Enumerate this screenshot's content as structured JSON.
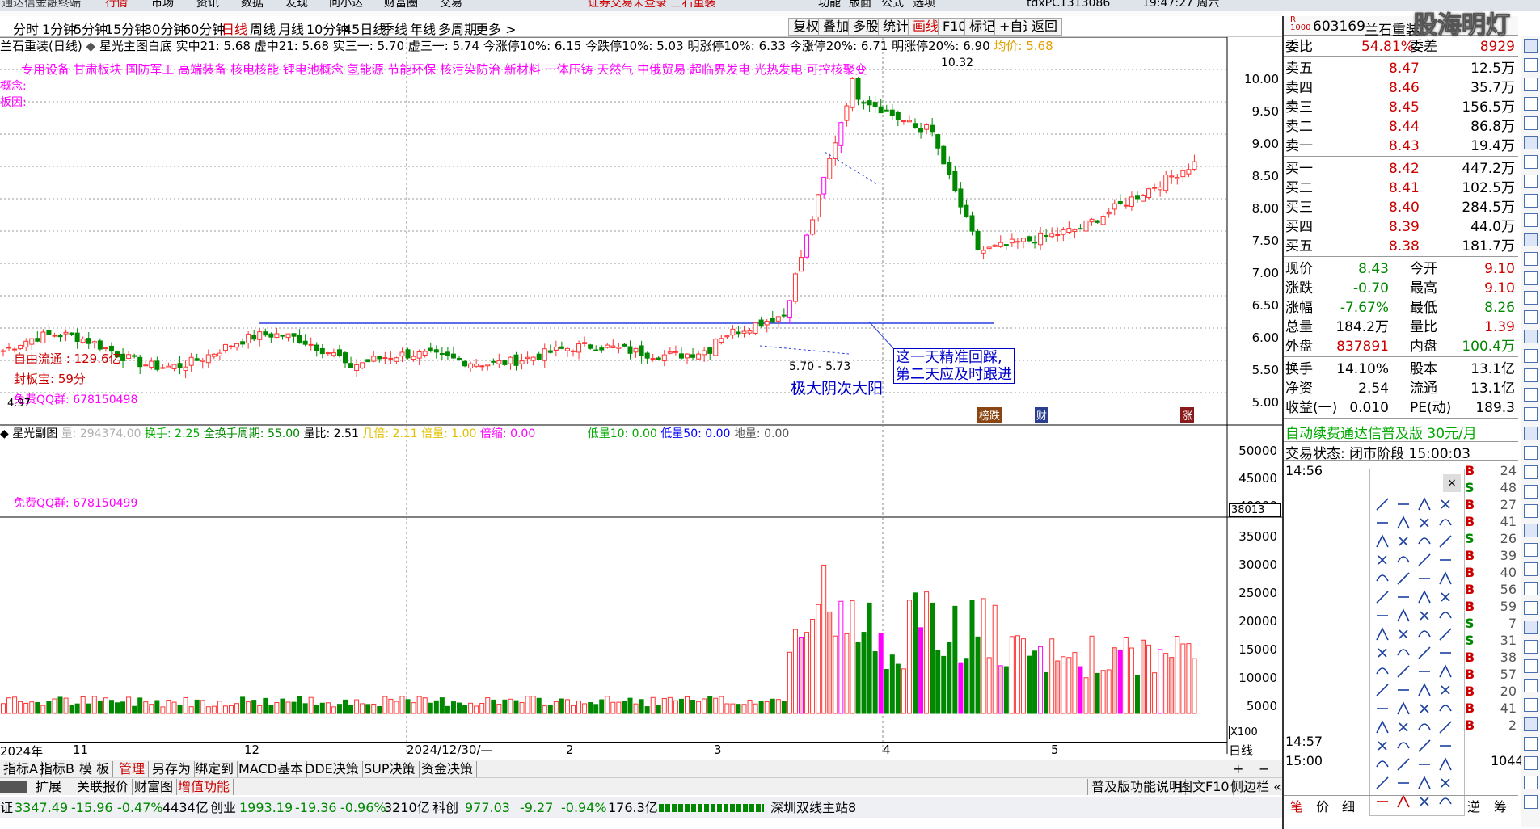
{
  "topbar": {
    "app_title": "通达信金融终端",
    "menus": [
      "行情",
      "市场",
      "资讯",
      "数据",
      "发现",
      "问小达",
      "财富圈",
      "交易"
    ],
    "notice": "证券交易未登录 三石重装",
    "right_menus": [
      "功能",
      "版面",
      "公式",
      "选项"
    ],
    "user": "tdxPC1313086",
    "time": "19:47:27 周六"
  },
  "periods": [
    "分时",
    "1分钟",
    "5分钟",
    "15分钟",
    "30分钟",
    "60分钟",
    "日线",
    "周线",
    "月线",
    "10分钟",
    "45日线",
    "季线",
    "年线",
    "多周期",
    "更多 >"
  ],
  "toolbar_buttons": [
    "复权",
    "叠加",
    "多股",
    "统计",
    "画线",
    "F10",
    "标记",
    "+自选",
    "返回"
  ],
  "header": {
    "stock_title": "兰石重装(日线)",
    "formula": "星光主图白底",
    "indicators": "实中21: 5.68  虚中21: 5.68  实三一: 5.70  虚三一: 5.74  今涨停10%: 6.15  今跌停10%: 5.03  明涨停10%: 6.33  今涨停20%: 6.71  明涨停20%: 6.90",
    "avg_price": "均价: 5.68"
  },
  "tags_line": "专用设备  甘肃板块  国防军工 高端装备 核电核能 锂电池概念 氢能源 节能环保 核污染防治 新材料 一体压铸 天然气 中俄贸易 超临界发电 光热发电 可控核聚变",
  "labels": {
    "concept": "概念:",
    "board_cause": "板因:",
    "free_float": "自由流通 : 129.6亿",
    "fengban": "封板宝: 59分",
    "qq_group": "免费QQ群: 678150498",
    "qq_group2": "免费QQ群: 678150499",
    "low_mark": "4.97",
    "high_mark": "10.32",
    "range_mark": "5.70 - 5.73",
    "annotation_a": "极大阴次大阳",
    "annotation_b": "这一天精准回踩,",
    "annotation_c": "第二天应及时跟进",
    "badge_1": "榜跌",
    "badge_2": "财",
    "badge_3": "涨"
  },
  "price_axis": [
    "10.00",
    "9.50",
    "9.00",
    "8.50",
    "8.00",
    "7.50",
    "7.00",
    "6.50",
    "6.00",
    "5.50",
    "5.00"
  ],
  "sub1": {
    "title": "星光副图",
    "items": [
      {
        "label": "量: 294374.00",
        "color": "#b0b0b0"
      },
      {
        "label": "换手: 2.25",
        "color": "#00aa00"
      },
      {
        "label": "全换手周期: 55.00",
        "color": "#008800"
      },
      {
        "label": "量比: 2.51",
        "color": "#000000"
      },
      {
        "label": "几倍: 2.11",
        "color": "#e0c000"
      },
      {
        "label": "倍量: 1.00",
        "color": "#e0c000"
      },
      {
        "label": "倍缩: 0.00",
        "color": "#ff00ff"
      },
      {
        "label": "低量10: 0.00",
        "color": "#00aa00"
      },
      {
        "label": "低量50: 0.00",
        "color": "#0000ff"
      },
      {
        "label": "地量: 0.00",
        "color": "#555555"
      }
    ],
    "axis": [
      "50000",
      "45000",
      "40000"
    ],
    "marker": "38013"
  },
  "volume_axis": [
    "35000",
    "30000",
    "25000",
    "20000",
    "15000",
    "10000",
    "5000"
  ],
  "volume_unit": "X100",
  "dates": [
    "2024年",
    "11",
    "12",
    "2024/12/30/—",
    "2",
    "3",
    "4",
    "5"
  ],
  "date_right": "日线",
  "bottom_tabs1": [
    "指标A",
    "指标B",
    "模 板",
    "管理",
    "另存为",
    "绑定到",
    "MACD基本",
    "DDE决策",
    "SUP决策",
    "资金决策"
  ],
  "bottom_tabs2": [
    "扩展",
    "关联报价",
    "财富图",
    "增值功能"
  ],
  "bottom_right": [
    "普及版功能说明",
    "图文F10",
    "侧边栏 «"
  ],
  "statusbar": {
    "sh": "证",
    "sh_val": "3347.49",
    "sh_chg": "-15.96",
    "sh_pct": "-0.47%",
    "sh_amt": "4434亿",
    "cy_name": "创业",
    "cy_val": "1993.19",
    "cy_chg": "-19.36",
    "cy_pct": "-0.96%",
    "cy_amt": "3210亿",
    "kc_name": "科创",
    "kc_val": "977.03",
    "kc_chg": "-9.27",
    "kc_pct": "-0.94%",
    "kc_amt": "176.3亿",
    "station": "深圳双线主站8"
  },
  "quote": {
    "code": "603169",
    "name": "兰石重装",
    "weibi_label": "委比",
    "weibi": "54.81%",
    "weicha_label": "委差",
    "weicha": "8929",
    "asks": [
      {
        "label": "卖五",
        "price": "8.47",
        "vol": "12.5万"
      },
      {
        "label": "卖四",
        "price": "8.46",
        "vol": "35.7万"
      },
      {
        "label": "卖三",
        "price": "8.45",
        "vol": "156.5万"
      },
      {
        "label": "卖二",
        "price": "8.44",
        "vol": "86.8万"
      },
      {
        "label": "卖一",
        "price": "8.43",
        "vol": "19.4万"
      }
    ],
    "bids": [
      {
        "label": "买一",
        "price": "8.42",
        "vol": "447.2万"
      },
      {
        "label": "买二",
        "price": "8.41",
        "vol": "102.5万"
      },
      {
        "label": "买三",
        "price": "8.40",
        "vol": "284.5万"
      },
      {
        "label": "买四",
        "price": "8.39",
        "vol": "44.0万"
      },
      {
        "label": "买五",
        "price": "8.38",
        "vol": "181.7万"
      }
    ],
    "stats": [
      {
        "l1": "现价",
        "v1": "8.43",
        "c1": "#008800",
        "l2": "今开",
        "v2": "9.10",
        "c2": "#cc0000"
      },
      {
        "l1": "涨跌",
        "v1": "-0.70",
        "c1": "#008800",
        "l2": "最高",
        "v2": "9.10",
        "c2": "#cc0000"
      },
      {
        "l1": "涨幅",
        "v1": "-7.67%",
        "c1": "#008800",
        "l2": "最低",
        "v2": "8.26",
        "c2": "#008800"
      },
      {
        "l1": "总量",
        "v1": "184.2万",
        "c1": "#000000",
        "l2": "量比",
        "v2": "1.39",
        "c2": "#cc0000"
      },
      {
        "l1": "外盘",
        "v1": "837891",
        "c1": "#cc0000",
        "l2": "内盘",
        "v2": "100.4万",
        "c2": "#008800"
      }
    ],
    "stats2": [
      {
        "l1": "换手",
        "v1": "14.10%",
        "l2": "股本",
        "v2": "13.1亿"
      },
      {
        "l1": "净资",
        "v1": "2.54",
        "l2": "流通",
        "v2": "13.1亿"
      },
      {
        "l1": "收益(一)",
        "v1": "0.010",
        "l2": "PE(动)",
        "v2": "189.3"
      }
    ],
    "ad": "自动续费通达信普及版 30元/月",
    "trade_state": "交易状态: 闭市阶段 15:00:03",
    "tick_time1": "14:56",
    "tick_time2": "14:57",
    "tick_time3": "15:00",
    "last_vol": "1044",
    "ticks": [
      {
        "s": "B",
        "v": "24"
      },
      {
        "s": "S",
        "v": "48"
      },
      {
        "s": "B",
        "v": "27"
      },
      {
        "s": "B",
        "v": "41"
      },
      {
        "s": "S",
        "v": "26"
      },
      {
        "s": "B",
        "v": "39"
      },
      {
        "s": "B",
        "v": "40"
      },
      {
        "s": "B",
        "v": "56"
      },
      {
        "s": "B",
        "v": "59"
      },
      {
        "s": "S",
        "v": "7"
      },
      {
        "s": "S",
        "v": "31"
      },
      {
        "s": "B",
        "v": "38"
      },
      {
        "s": "B",
        "v": "57"
      },
      {
        "s": "B",
        "v": "20"
      },
      {
        "s": "B",
        "v": "41"
      },
      {
        "s": "B",
        "v": "2"
      }
    ],
    "bottom_tabs": [
      "笔",
      "价",
      "细",
      "逆",
      "筹"
    ]
  },
  "watermark": "股海明灯",
  "side_icons": [
    "RSI",
    "年",
    "月",
    "日",
    "周",
    "多",
    "季",
    "年"
  ],
  "colors": {
    "up": "#ff3333",
    "down": "#008800",
    "limit": "#ff00ff",
    "accent": "#0000ff"
  }
}
